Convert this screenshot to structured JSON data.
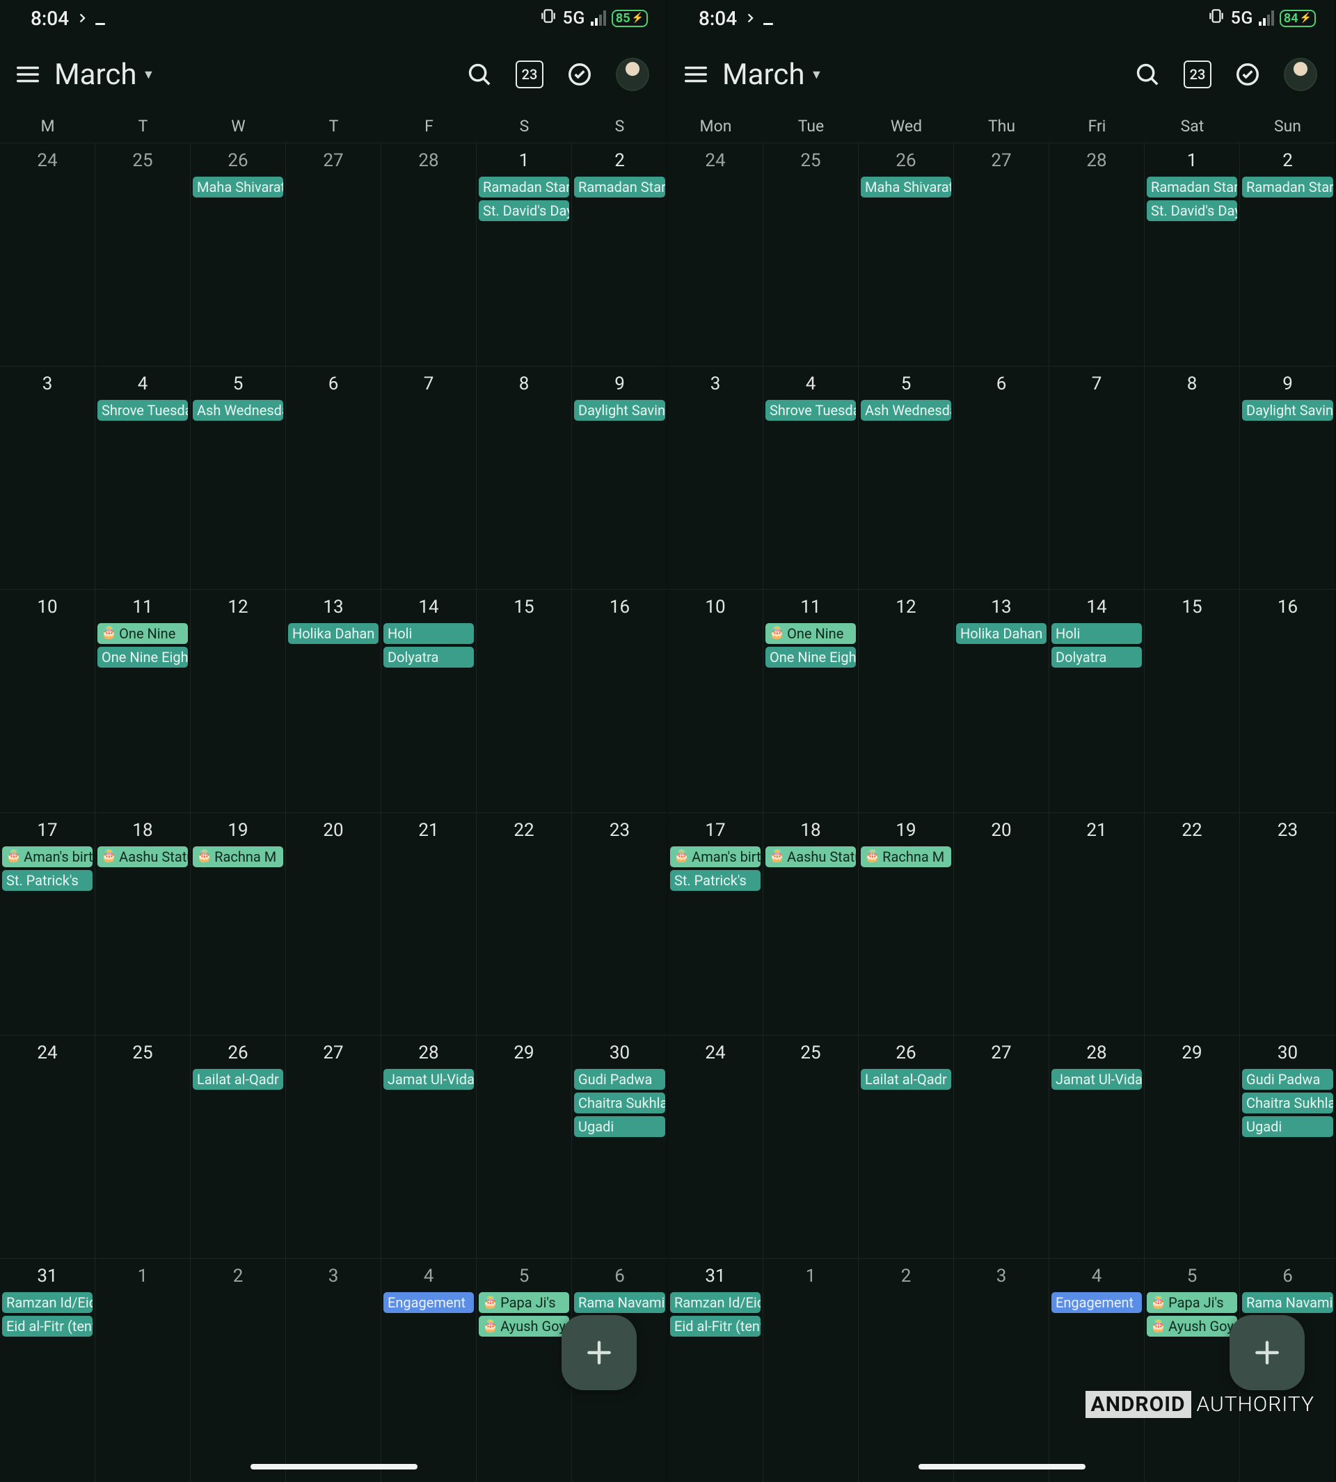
{
  "status": {
    "time": "8:04",
    "network_label": "5G",
    "battery_left": "85",
    "battery_right": "84"
  },
  "header": {
    "month": "March",
    "today_number": "23"
  },
  "day_headers_short": [
    "M",
    "T",
    "W",
    "T",
    "F",
    "S",
    "S"
  ],
  "day_headers_long": [
    "Mon",
    "Tue",
    "Wed",
    "Thu",
    "Fri",
    "Sat",
    "Sun"
  ],
  "grid": [
    [
      {
        "date": "24",
        "dim": true,
        "events": []
      },
      {
        "date": "25",
        "dim": true,
        "events": []
      },
      {
        "date": "26",
        "dim": true,
        "events": [
          {
            "label": "Maha Shivaratri",
            "color": "teal"
          }
        ]
      },
      {
        "date": "27",
        "dim": true,
        "events": []
      },
      {
        "date": "28",
        "dim": true,
        "events": []
      },
      {
        "date": "1",
        "events": [
          {
            "label": "Ramadan Start",
            "color": "teal"
          },
          {
            "label": "St. David's Day",
            "color": "teal"
          }
        ]
      },
      {
        "date": "2",
        "events": [
          {
            "label": "Ramadan Start",
            "color": "teal"
          }
        ]
      }
    ],
    [
      {
        "date": "3",
        "events": []
      },
      {
        "date": "4",
        "events": [
          {
            "label": "Shrove Tuesday",
            "color": "teal"
          }
        ]
      },
      {
        "date": "5",
        "events": [
          {
            "label": "Ash Wednesday",
            "color": "teal"
          }
        ]
      },
      {
        "date": "6",
        "events": []
      },
      {
        "date": "7",
        "events": []
      },
      {
        "date": "8",
        "events": []
      },
      {
        "date": "9",
        "events": [
          {
            "label": "Daylight Saving",
            "color": "teal"
          }
        ]
      }
    ],
    [
      {
        "date": "10",
        "events": []
      },
      {
        "date": "11",
        "events": [
          {
            "label": "One Nine",
            "color": "mint",
            "cake": true
          },
          {
            "label": "One Nine Eight",
            "color": "teal"
          }
        ]
      },
      {
        "date": "12",
        "events": []
      },
      {
        "date": "13",
        "events": [
          {
            "label": "Holika Dahan",
            "color": "teal"
          }
        ]
      },
      {
        "date": "14",
        "events": [
          {
            "label": "Holi",
            "color": "teal"
          },
          {
            "label": "Dolyatra",
            "color": "teal"
          }
        ]
      },
      {
        "date": "15",
        "events": []
      },
      {
        "date": "16",
        "events": []
      }
    ],
    [
      {
        "date": "17",
        "events": [
          {
            "label": "Aman's birthday",
            "color": "mint",
            "cake": true
          },
          {
            "label": "St. Patrick's",
            "color": "teal"
          }
        ]
      },
      {
        "date": "18",
        "events": [
          {
            "label": "Aashu Status",
            "color": "mint",
            "cake": true
          }
        ]
      },
      {
        "date": "19",
        "events": [
          {
            "label": "Rachna M",
            "color": "mint",
            "cake": true
          }
        ]
      },
      {
        "date": "20",
        "events": []
      },
      {
        "date": "21",
        "events": []
      },
      {
        "date": "22",
        "events": []
      },
      {
        "date": "23",
        "events": []
      }
    ],
    [
      {
        "date": "24",
        "events": []
      },
      {
        "date": "25",
        "events": []
      },
      {
        "date": "26",
        "events": [
          {
            "label": "Lailat al-Qadr",
            "color": "teal"
          }
        ]
      },
      {
        "date": "27",
        "events": []
      },
      {
        "date": "28",
        "events": [
          {
            "label": "Jamat Ul-Vida",
            "color": "teal"
          }
        ]
      },
      {
        "date": "29",
        "events": []
      },
      {
        "date": "30",
        "events": [
          {
            "label": "Gudi Padwa",
            "color": "teal"
          },
          {
            "label": "Chaitra Sukhladi",
            "color": "teal"
          },
          {
            "label": "Ugadi",
            "color": "teal"
          }
        ]
      }
    ],
    [
      {
        "date": "31",
        "events": [
          {
            "label": "Ramzan Id/Eid",
            "color": "teal"
          },
          {
            "label": "Eid al-Fitr (tentative)",
            "color": "teal"
          }
        ]
      },
      {
        "date": "1",
        "dim": true,
        "events": []
      },
      {
        "date": "2",
        "dim": true,
        "events": []
      },
      {
        "date": "3",
        "dim": true,
        "events": []
      },
      {
        "date": "4",
        "dim": true,
        "events": [
          {
            "label": "Engagement",
            "color": "blue"
          }
        ]
      },
      {
        "date": "5",
        "dim": true,
        "events": [
          {
            "label": "Papa Ji's",
            "color": "mint",
            "cake": true
          },
          {
            "label": "Ayush Goyal",
            "color": "mint",
            "cake": true
          }
        ]
      },
      {
        "date": "6",
        "dim": true,
        "events": [
          {
            "label": "Rama Navami",
            "color": "teal"
          }
        ]
      }
    ]
  ],
  "watermark": {
    "bold": "ANDROID",
    "light": "AUTHORITY"
  }
}
